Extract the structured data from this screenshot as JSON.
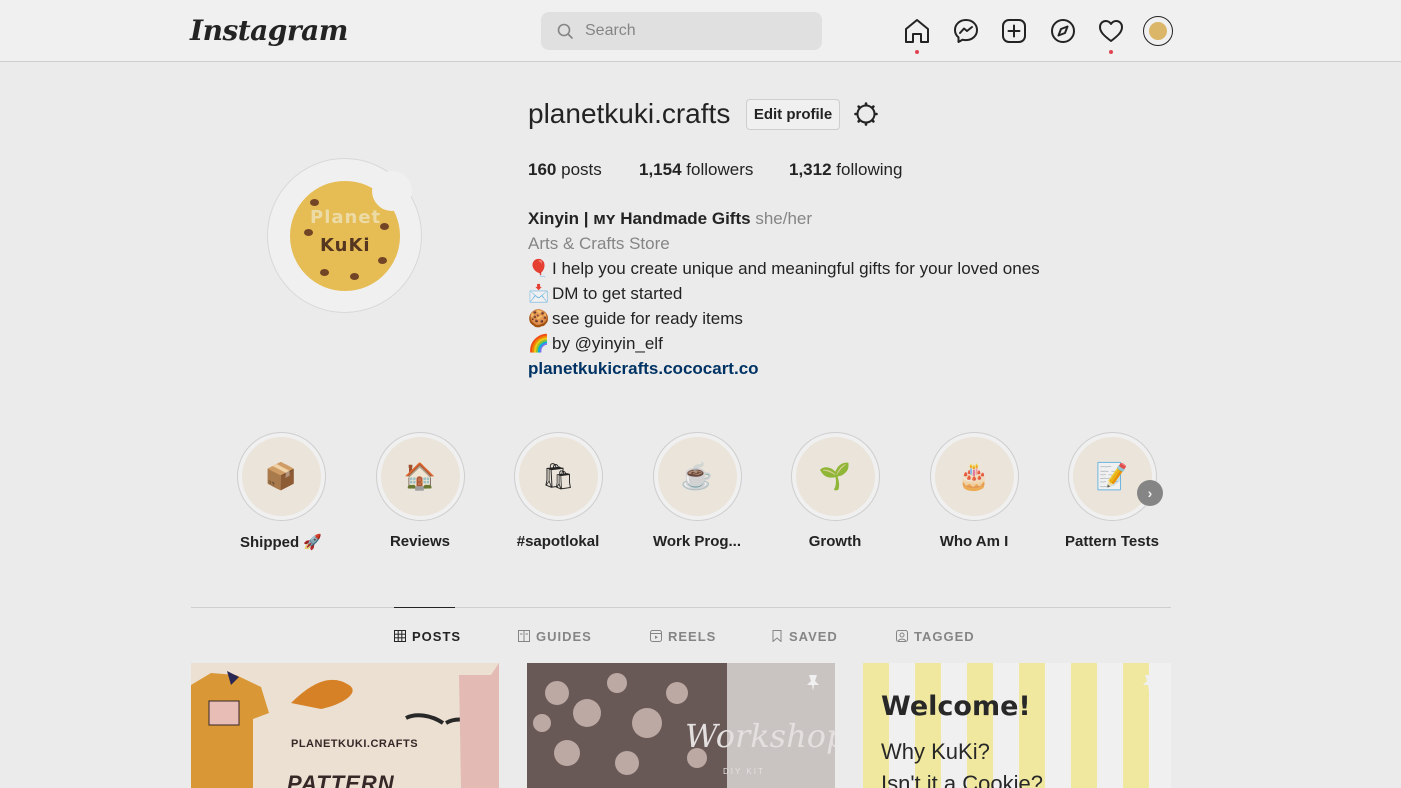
{
  "app": {
    "logo": "Instagram"
  },
  "search": {
    "placeholder": "Search",
    "value": ""
  },
  "nav": {
    "icons": [
      "home-icon",
      "messenger-icon",
      "new-post-icon",
      "explore-icon",
      "activity-icon",
      "profile-avatar"
    ],
    "notifications": [
      "home",
      "activity"
    ]
  },
  "profile": {
    "username": "planetkuki.crafts",
    "edit_label": "Edit profile",
    "avatar_text_top": "Planet",
    "avatar_text_bottom": "KuKi",
    "stats": {
      "posts_count": "160",
      "posts_label": "posts",
      "followers_count": "1,154",
      "followers_label": "followers",
      "following_count": "1,312",
      "following_label": "following"
    },
    "bio": {
      "name": "Xinyin | ᴍʏ Handmade Gifts",
      "pronouns": "she/her",
      "category": "Arts & Crafts Store",
      "line1_emoji": "🎈",
      "line1": "I help you create unique and meaningful gifts for your loved ones",
      "line2_emoji": "📩",
      "line2": "DM to get started",
      "line3_emoji": "🍪",
      "line3": "see guide for ready items",
      "line4_emoji": "🌈",
      "line4": "by @yinyin_elf",
      "link": "planetkukicrafts.cococart.co"
    }
  },
  "highlights": [
    {
      "label": "Shipped 🚀",
      "icon": "📦"
    },
    {
      "label": "Reviews",
      "icon": "🏠"
    },
    {
      "label": "#sapotlokal",
      "icon": "🛍"
    },
    {
      "label": "Work Prog...",
      "icon": "☕"
    },
    {
      "label": "Growth",
      "icon": "🌱"
    },
    {
      "label": "Who Am I",
      "icon": "🎂"
    },
    {
      "label": "Pattern Tests",
      "icon": "📝"
    }
  ],
  "tabs": [
    {
      "label": "POSTS",
      "active": true
    },
    {
      "label": "GUIDES",
      "active": false
    },
    {
      "label": "REELS",
      "active": false
    },
    {
      "label": "SAVED",
      "active": false
    },
    {
      "label": "TAGGED",
      "active": false
    }
  ],
  "posts": {
    "p1_title": "PLANETKUKI.CRAFTS",
    "p1_sub": "PATTERN",
    "p2_title": "Workshop",
    "p2_sub": "DIY KIT",
    "p3_title": "Welcome!",
    "p3_line1": "Why KuKi?",
    "p3_line2": "Isn't it a Cookie?"
  },
  "colors": {
    "accent": "#ed4956",
    "link": "#00376b",
    "muted": "#8e8e8e"
  }
}
